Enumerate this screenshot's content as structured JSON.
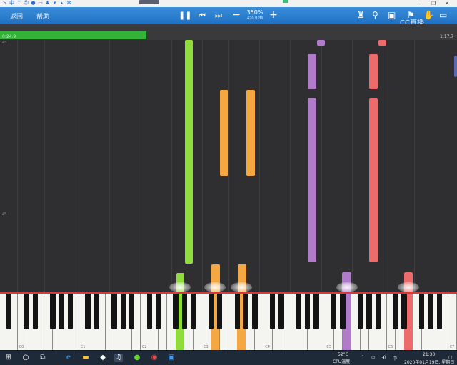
{
  "menu": {
    "back": "返回",
    "help": "帮助"
  },
  "playback": {
    "tempo": "350%",
    "bpm": "420 BPM",
    "pause_icon": "pause-icon",
    "prev_icon": "skip-back-icon",
    "next_icon": "skip-forward-icon",
    "minus": "−",
    "plus": "+"
  },
  "watermark": "CC直播",
  "progress": {
    "elapsed": "0:24.9",
    "total": "1:17.7",
    "fraction": 0.32
  },
  "roll": {
    "label_top": "45",
    "label_mid": "45"
  },
  "keyboard": {
    "labels": [
      "C0",
      "C1",
      "C2",
      "C3",
      "C4",
      "C5",
      "C6",
      "C7"
    ]
  },
  "taskbar": {
    "temp": "52°C",
    "temp_label": "CPU温度",
    "ime": "中",
    "time": "21:30",
    "date": "2020年01月19日, 星期日"
  },
  "colors": {
    "accent": "#1f6fc4",
    "green": "#8fdc3c",
    "orange": "#f5a742",
    "purple": "#b07cc9",
    "red": "#ee6b6b",
    "progress": "#35b23a"
  }
}
